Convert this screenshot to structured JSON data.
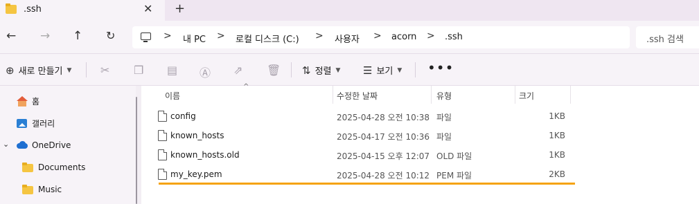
{
  "window": {
    "tab_title": ".ssh",
    "close_glyph": "✕",
    "new_tab_glyph": "+"
  },
  "nav": {
    "back_icon": "arrow-left-icon",
    "forward_icon": "arrow-right-icon",
    "up_icon": "arrow-up-icon",
    "refresh_icon": "refresh-icon",
    "breadcrumbs": [
      "내 PC",
      "로컬 디스크 (C:)",
      "사용자",
      "acorn",
      ".ssh"
    ],
    "separator": ">",
    "search_placeholder": ".ssh 검색"
  },
  "toolbar": {
    "new_label": "새로 만들기",
    "sort_label": "정렬",
    "view_label": "보기",
    "more_label": "•••"
  },
  "sidebar": {
    "items": [
      {
        "label": "홈",
        "icon": "home-icon"
      },
      {
        "label": "갤러리",
        "icon": "gallery-icon"
      },
      {
        "label": "OneDrive",
        "icon": "onedrive-cloud-icon"
      },
      {
        "label": "Documents",
        "icon": "folder-icon"
      },
      {
        "label": "Music",
        "icon": "folder-icon"
      }
    ]
  },
  "columns": {
    "name": "이름",
    "modified": "수정한 날짜",
    "type": "유형",
    "size": "크기"
  },
  "files": [
    {
      "name": "config",
      "modified": "2025-04-28 오전 10:38",
      "type": "파일",
      "size": "1KB"
    },
    {
      "name": "known_hosts",
      "modified": "2025-04-17 오전 10:36",
      "type": "파일",
      "size": "1KB"
    },
    {
      "name": "known_hosts.old",
      "modified": "2025-04-15 오후 12:07",
      "type": "OLD 파일",
      "size": "1KB"
    },
    {
      "name": "my_key.pem",
      "modified": "2025-04-28 오전 10:12",
      "type": "PEM 파일",
      "size": "2KB"
    }
  ],
  "colors": {
    "highlight_underline": "#f5a30f",
    "folder": "#f5c542"
  }
}
